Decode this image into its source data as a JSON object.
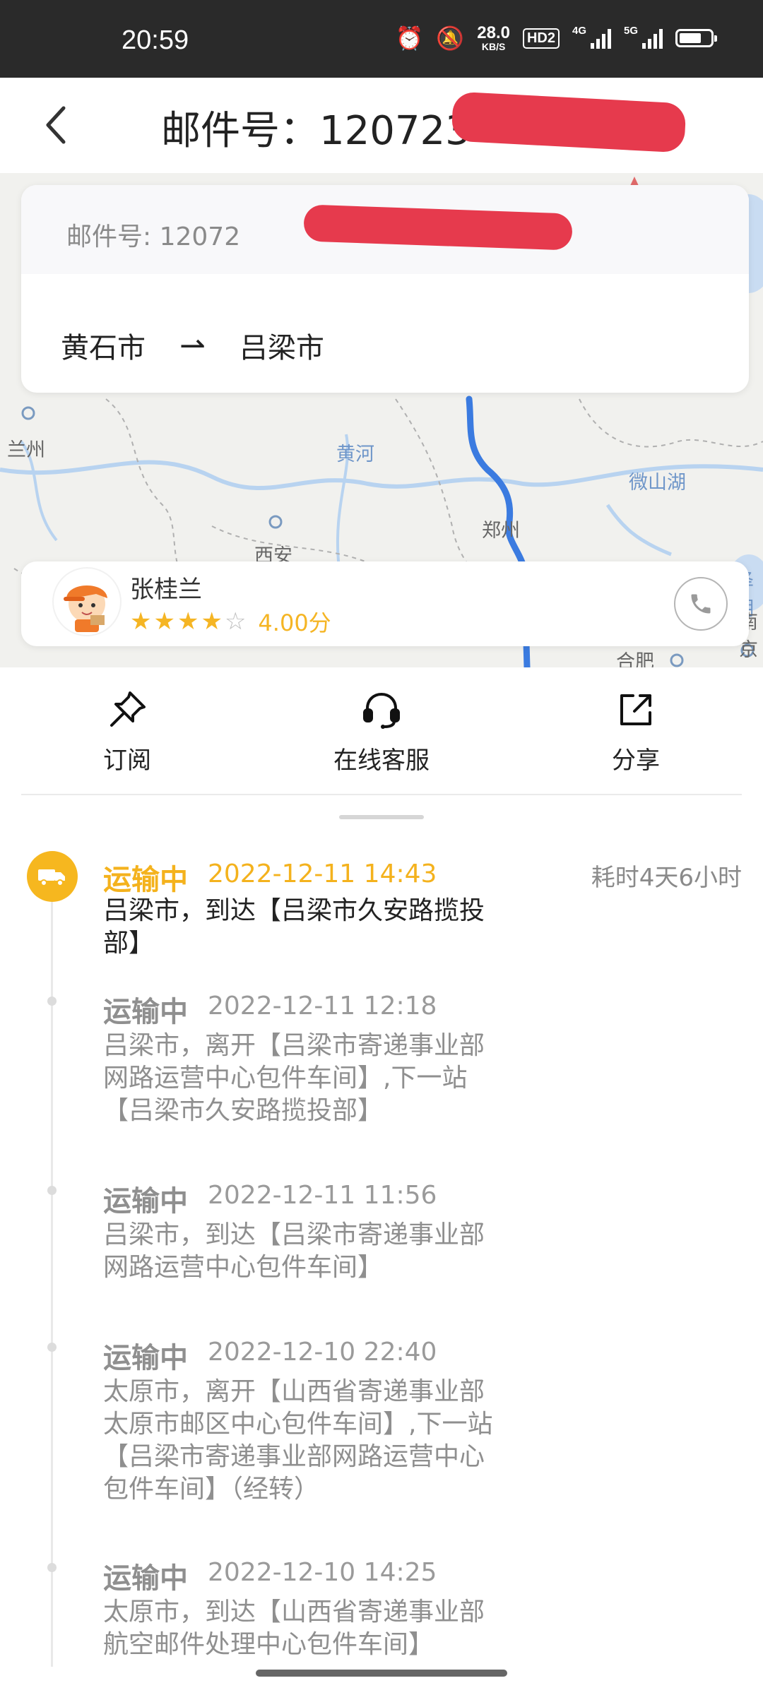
{
  "status_bar": {
    "time": "20:59",
    "speed_value": "28.0",
    "speed_unit": "KB/S",
    "hd_label": "HD2",
    "net1": "4G",
    "net2": "5G",
    "icons": [
      "alarm-icon",
      "mute-icon",
      "hd-icon",
      "signal-icon",
      "signal-icon",
      "battery-icon"
    ]
  },
  "header": {
    "title": "邮件号：120723",
    "back_icon": "back-chevron-icon"
  },
  "map": {
    "labels": {
      "lanzhou": "兰州",
      "huanghe": "黄河",
      "weishanhu": "微山湖",
      "zhengzhou": "郑州",
      "xian": "西安",
      "hefei": "合肥",
      "right_edge_1": "泽湖",
      "right_edge_2": "南京"
    },
    "route_color": "#3b7be0"
  },
  "route_card": {
    "mail_no": "邮件号: 12072",
    "from": "黄石市",
    "arrow": "⇀",
    "to": "吕梁市"
  },
  "courier": {
    "name": "张桂兰",
    "rating_stars": 4,
    "rating_max": 5,
    "score_text": "4.00分",
    "phone_icon": "phone-icon"
  },
  "actions": {
    "subscribe": "订阅",
    "support": "在线客服",
    "share": "分享"
  },
  "timeline": {
    "duration": "耗时4天6小时",
    "events": [
      {
        "status": "运输中",
        "time": "2022-12-11  14:43",
        "desc": "吕梁市，到达【吕梁市久安路揽投部】"
      },
      {
        "status": "运输中",
        "time": "2022-12-11  12:18",
        "desc": "吕梁市，离开【吕梁市寄递事业部网路运营中心包件车间】,下一站【吕梁市久安路揽投部】"
      },
      {
        "status": "运输中",
        "time": "2022-12-11  11:56",
        "desc": "吕梁市，到达【吕梁市寄递事业部网路运营中心包件车间】"
      },
      {
        "status": "运输中",
        "time": "2022-12-10  22:40",
        "desc": "太原市，离开【山西省寄递事业部太原市邮区中心包件车间】,下一站【吕梁市寄递事业部网路运营中心包件车间】（经转）"
      },
      {
        "status": "运输中",
        "time": "2022-12-10  14:25",
        "desc": "太原市，到达【山西省寄递事业部航空邮件处理中心包件车间】"
      }
    ]
  },
  "colors": {
    "accent": "#f6b71f",
    "redaction": "#e63a4d",
    "status_bar_bg": "#2a2a2a"
  }
}
